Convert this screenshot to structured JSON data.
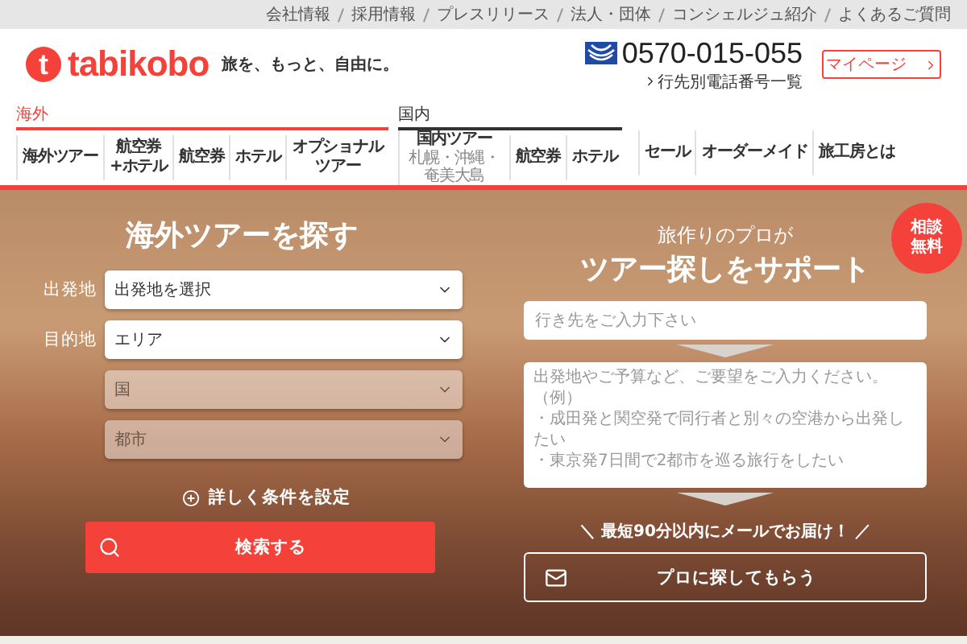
{
  "top_links": [
    "会社情報",
    "採用情報",
    "プレスリリース",
    "法人・団体",
    "コンシェルジュ紹介",
    "よくあるご質問"
  ],
  "header": {
    "logo_mark": "t",
    "logo_text": "tabikobo",
    "tagline": "旅を、もっと、自由に。",
    "phone": "0570-015-055",
    "phone_link": "行先別電話番号一覧",
    "mypage": "マイページ"
  },
  "nav": {
    "groups": [
      {
        "label": "海外",
        "selected": true,
        "items": [
          {
            "lines": [
              "海外ツアー"
            ]
          },
          {
            "lines": [
              "航空券",
              "+ホテル"
            ]
          },
          {
            "lines": [
              "航空券"
            ]
          },
          {
            "lines": [
              "ホテル"
            ]
          },
          {
            "lines": [
              "オプショナル",
              "ツアー"
            ]
          }
        ]
      },
      {
        "label": "国内",
        "selected": false,
        "items": [
          {
            "lines": [
              "国内ツアー"
            ],
            "sub": "札幌・沖縄・奄美大島"
          },
          {
            "lines": [
              "航空券"
            ]
          },
          {
            "lines": [
              "ホテル"
            ]
          }
        ]
      }
    ],
    "extra_items": [
      "セール",
      "オーダーメイド",
      "旅工房とは"
    ]
  },
  "search_panel": {
    "title": "海外ツアーを探す",
    "fields": [
      {
        "label": "出発地",
        "value": "出発地を選択",
        "disabled": false
      },
      {
        "label": "目的地",
        "value": "エリア",
        "disabled": false
      },
      {
        "value": "国",
        "disabled": true
      },
      {
        "value": "都市",
        "disabled": true
      }
    ],
    "detail_link": "詳しく条件を設定",
    "search_button": "検索する"
  },
  "consult_panel": {
    "subtitle": "旅作りのプロが",
    "title": "ツアー探しをサポート",
    "badge": [
      "相談",
      "無料"
    ],
    "destination_placeholder": "行き先をご入力下さい",
    "request_placeholder": [
      "出発地やご予算など、ご要望をご入力ください。",
      "（例）",
      "・成田発と関空発で同行者と別々の空港から出発したい",
      "・東京発7日間で2都市を巡る旅行をしたい"
    ],
    "note": "＼ 最短90分以内にメールでお届け！ ／",
    "submit_button": "プロに探してもらう"
  }
}
